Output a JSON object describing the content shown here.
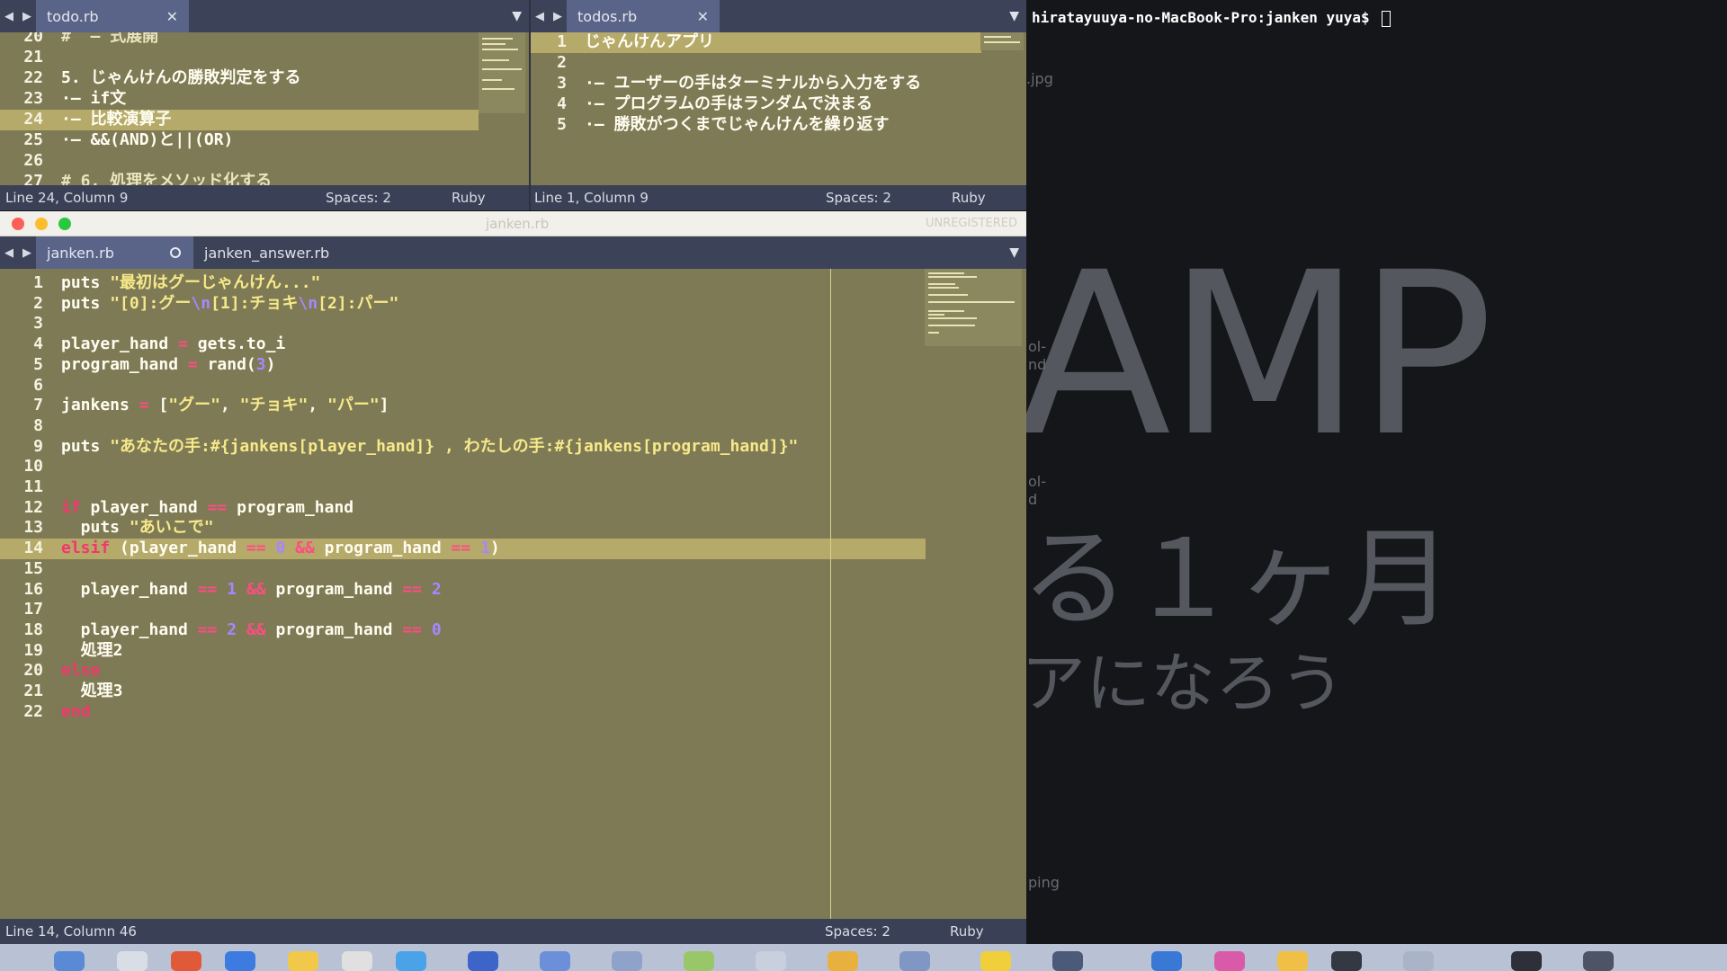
{
  "topLeft": {
    "tab": "todo.rb",
    "lines": [
      {
        "n": "20",
        "text": "#  — 式展開"
      },
      {
        "n": "21",
        "text": ""
      },
      {
        "n": "22",
        "text": "5. じゃんけんの勝敗判定をする"
      },
      {
        "n": "23",
        "text": "·— if文"
      },
      {
        "n": "24",
        "text": "·— 比較演算子"
      },
      {
        "n": "25",
        "text": "·— &&(AND)と||(OR)"
      },
      {
        "n": "26",
        "text": ""
      },
      {
        "n": "27",
        "text": "# 6. 処理をメソッド化する"
      }
    ],
    "status": {
      "pos": "Line 24, Column 9",
      "spaces": "Spaces: 2",
      "lang": "Ruby"
    }
  },
  "topRight": {
    "tab": "todos.rb",
    "lines": [
      {
        "n": "1",
        "text": "じゃんけんアプリ"
      },
      {
        "n": "2",
        "text": ""
      },
      {
        "n": "3",
        "text": "·— ユーザーの手はターミナルから入力をする"
      },
      {
        "n": "4",
        "text": "·— プログラムの手はランダムで決まる"
      },
      {
        "n": "5",
        "text": "·— 勝敗がつくまでじゃんけんを繰り返す"
      }
    ],
    "status": {
      "pos": "Line 1, Column 9",
      "spaces": "Spaces: 2",
      "lang": "Ruby"
    }
  },
  "window": {
    "title": "janken.rb",
    "unregistered": "UNREGISTERED"
  },
  "main": {
    "tabs": [
      "janken.rb",
      "janken_answer.rb"
    ],
    "status": {
      "pos": "Line 14, Column 46",
      "spaces": "Spaces: 2",
      "lang": "Ruby"
    }
  },
  "terminal": {
    "prompt": "hiratayuuya-no-MacBook-Pro:janken yuya$ ",
    "bg": {
      "big": "AMP",
      "mid": "る１ヶ月",
      "low": "アになろう",
      "jpg": ".jpg",
      "ol1": "ol-",
      "nd1": "nd",
      "ol2": "ol-",
      "d2": "d",
      "ping": "ping"
    }
  }
}
